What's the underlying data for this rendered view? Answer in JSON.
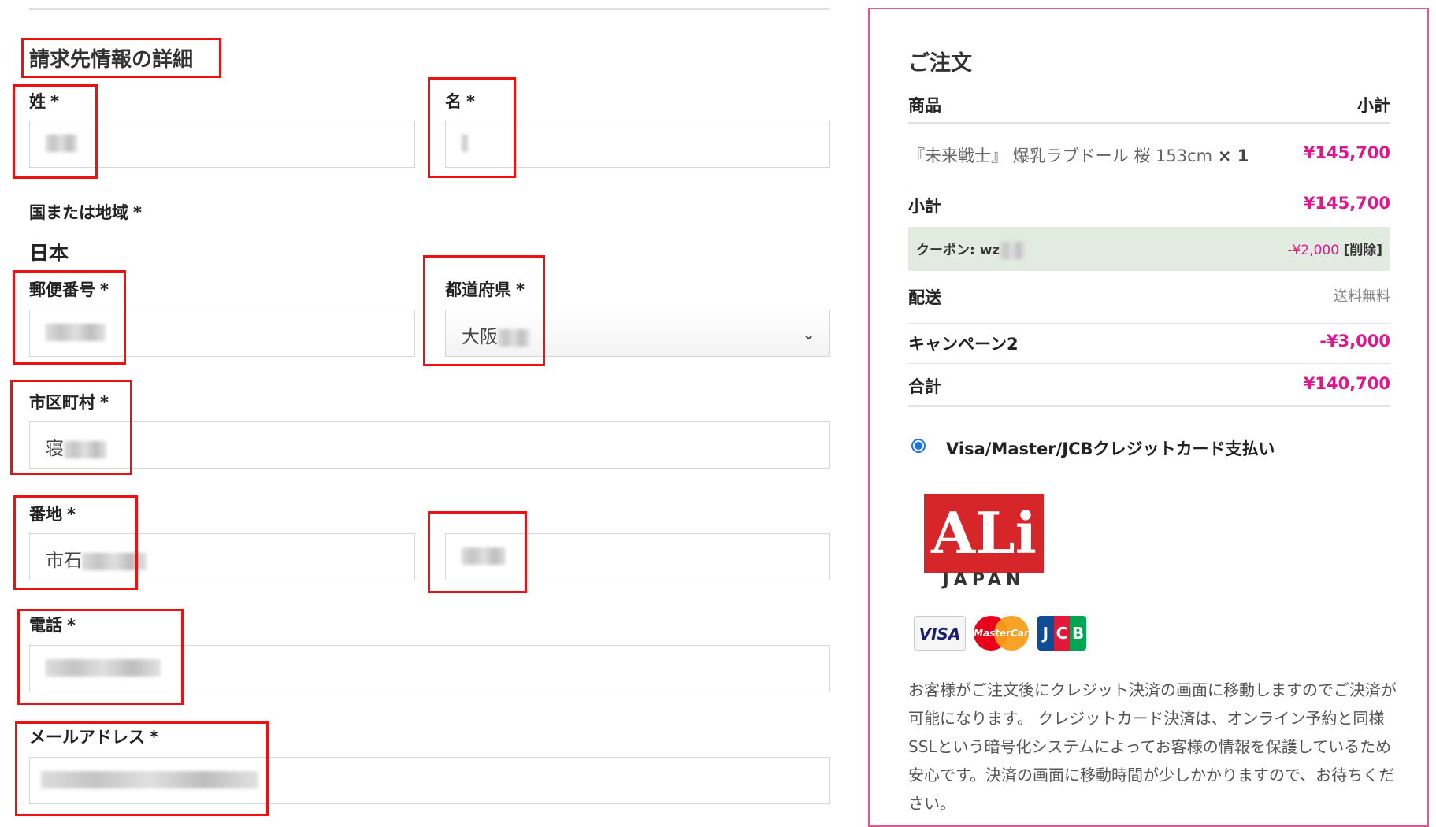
{
  "form": {
    "section_title": "請求先情報の詳細",
    "required_mark": "*",
    "last_name_label": "姓",
    "first_name_label": "名",
    "country_label": "国または地域",
    "country_value": "日本",
    "postcode_label": "郵便番号",
    "prefecture_label": "都道府県",
    "prefecture_value": "大阪",
    "city_label": "市区町村",
    "city_value": "寝",
    "address_label": "番地",
    "address_value": "市石",
    "phone_label": "電話",
    "email_label": "メールアドレス"
  },
  "order": {
    "title": "ご注文",
    "col_product": "商品",
    "col_subtotal": "小計",
    "item_name": "『未来戦士』 爆乳ラブドール 桜 153cm",
    "item_qty": "× 1",
    "item_price": "¥145,700",
    "subtotal_label": "小計",
    "subtotal_value": "¥145,700",
    "coupon_label": "クーポン: wz",
    "coupon_value": "-¥2,000",
    "coupon_remove": "[削除]",
    "shipping_label": "配送",
    "shipping_value": "送料無料",
    "campaign_label": "キャンペーン2",
    "campaign_value": "-¥3,000",
    "total_label": "合計",
    "total_value": "¥140,700"
  },
  "payment": {
    "method_label": "Visa/Master/JCBクレジットカード支払い",
    "logo_text": "ALi",
    "logo_sub": "JAPAN",
    "visa_text": "VISA",
    "master_text": "MasterCard",
    "jcb_letters": [
      "J",
      "C",
      "B"
    ],
    "description": "お客様がご注文後にクレジット決済の画面に移動しますのでご決済が可能になります。 クレジットカード決済は、オンライン予約と同様SSLという暗号化システムによってお客様の情報を保護しているため安心です。決済の画面に移動時間が少しかかりますので、お待ちください。"
  },
  "colors": {
    "accent_pink": "#e0168e",
    "panel_border": "#e1578f",
    "annotation_red": "#ee1111",
    "coupon_bg": "#e2ebe0"
  }
}
